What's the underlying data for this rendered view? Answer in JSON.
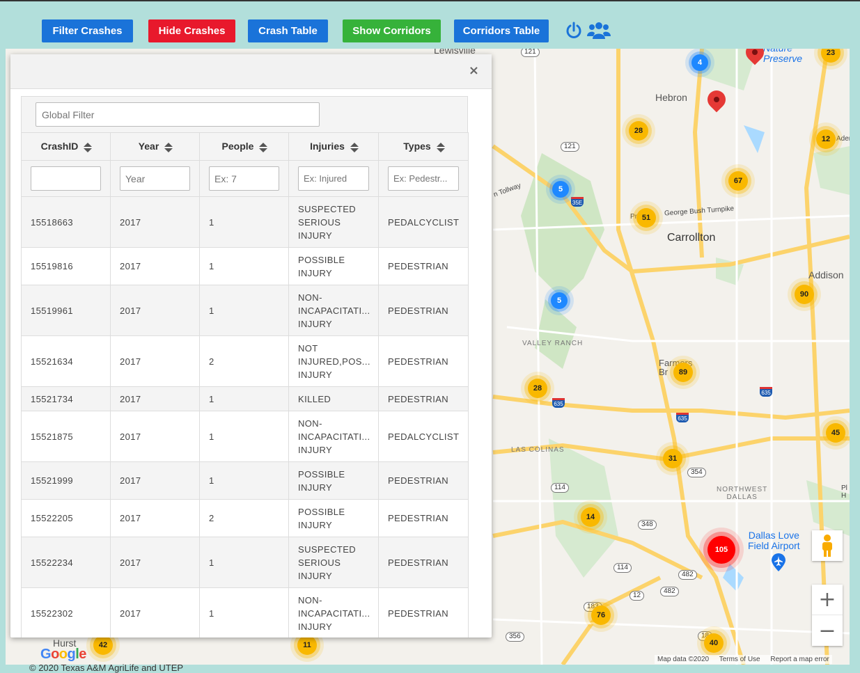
{
  "toolbar": {
    "filter_crashes": "Filter Crashes",
    "hide_crashes": "Hide Crashes",
    "crash_table": "Crash Table",
    "show_corridors": "Show Corridors",
    "corridors_table": "Corridors Table",
    "colors": {
      "blue": "#1a73d9",
      "red": "#e8192c",
      "green": "#36b23a"
    }
  },
  "dialog": {
    "close": "×",
    "global_filter_placeholder": "Global Filter",
    "columns": [
      {
        "label": "CrashID",
        "filter_placeholder": ""
      },
      {
        "label": "Year",
        "filter_placeholder": "Year"
      },
      {
        "label": "People",
        "filter_placeholder": "Ex: 7"
      },
      {
        "label": "Injuries",
        "filter_placeholder": "Ex: Injured"
      },
      {
        "label": "Types",
        "filter_placeholder": "Ex: Pedestr..."
      }
    ],
    "rows": [
      {
        "id": "15518663",
        "year": "2017",
        "people": "1",
        "injuries": "SUSPECTED\nSERIOUS\nINJURY",
        "type": "PEDALCYCLIST"
      },
      {
        "id": "15519816",
        "year": "2017",
        "people": "1",
        "injuries": "POSSIBLE\nINJURY",
        "type": "PEDESTRIAN"
      },
      {
        "id": "15519961",
        "year": "2017",
        "people": "1",
        "injuries": "NON-\nINCAPACITATI...\nINJURY",
        "type": "PEDESTRIAN"
      },
      {
        "id": "15521634",
        "year": "2017",
        "people": "2",
        "injuries": "NOT\nINJURED,POS...\nINJURY",
        "type": "PEDESTRIAN"
      },
      {
        "id": "15521734",
        "year": "2017",
        "people": "1",
        "injuries": "KILLED",
        "type": "PEDESTRIAN"
      },
      {
        "id": "15521875",
        "year": "2017",
        "people": "1",
        "injuries": "NON-\nINCAPACITATI...\nINJURY",
        "type": "PEDALCYCLIST"
      },
      {
        "id": "15521999",
        "year": "2017",
        "people": "1",
        "injuries": "POSSIBLE\nINJURY",
        "type": "PEDESTRIAN"
      },
      {
        "id": "15522205",
        "year": "2017",
        "people": "2",
        "injuries": "POSSIBLE\nINJURY",
        "type": "PEDESTRIAN"
      },
      {
        "id": "15522234",
        "year": "2017",
        "people": "1",
        "injuries": "SUSPECTED\nSERIOUS\nINJURY",
        "type": "PEDESTRIAN"
      },
      {
        "id": "15522302",
        "year": "2017",
        "people": "1",
        "injuries": "NON-\nINCAPACITATI...\nINJURY",
        "type": "PEDESTRIAN"
      }
    ]
  },
  "map": {
    "places": {
      "lewisville": "Lewisville",
      "nature_preserve": "Nature\nPreserve",
      "hebron": "Hebron",
      "carrollton": "Carrollton",
      "addison": "Addison",
      "valley_ranch": "VALLEY RANCH",
      "farmers_branch": "Farmers\nBr",
      "las_colinas": "LAS COLINAS",
      "northwest_dallas": "NORTHWEST\nDALLAS",
      "dallas_love": "Dallas Love\nField Airport",
      "hurst": "Hurst",
      "george_bush": "George Bush Turnpike",
      "tollway": "n Tollway",
      "pr": "Pr",
      "pl": "Pl\nH",
      "aden": "Aden"
    },
    "shields": [
      "121",
      "121",
      "35E",
      "635",
      "635",
      "635",
      "354",
      "114",
      "348",
      "114",
      "482",
      "482",
      "12",
      "183",
      "356",
      "18",
      "10",
      "183"
    ],
    "clusters": [
      "4",
      "23",
      "28",
      "12",
      "5",
      "67",
      "51",
      "90",
      "5",
      "89",
      "28",
      "45",
      "31",
      "14",
      "105",
      "76",
      "40",
      "42",
      "11"
    ],
    "brand": "Google",
    "copyright": "© 2020 Texas A&M AgriLife and UTEP",
    "map_data": "Map data ©2020",
    "terms": "Terms of Use",
    "report": "Report a map error",
    "zoom_in": "+",
    "zoom_out": "−"
  }
}
